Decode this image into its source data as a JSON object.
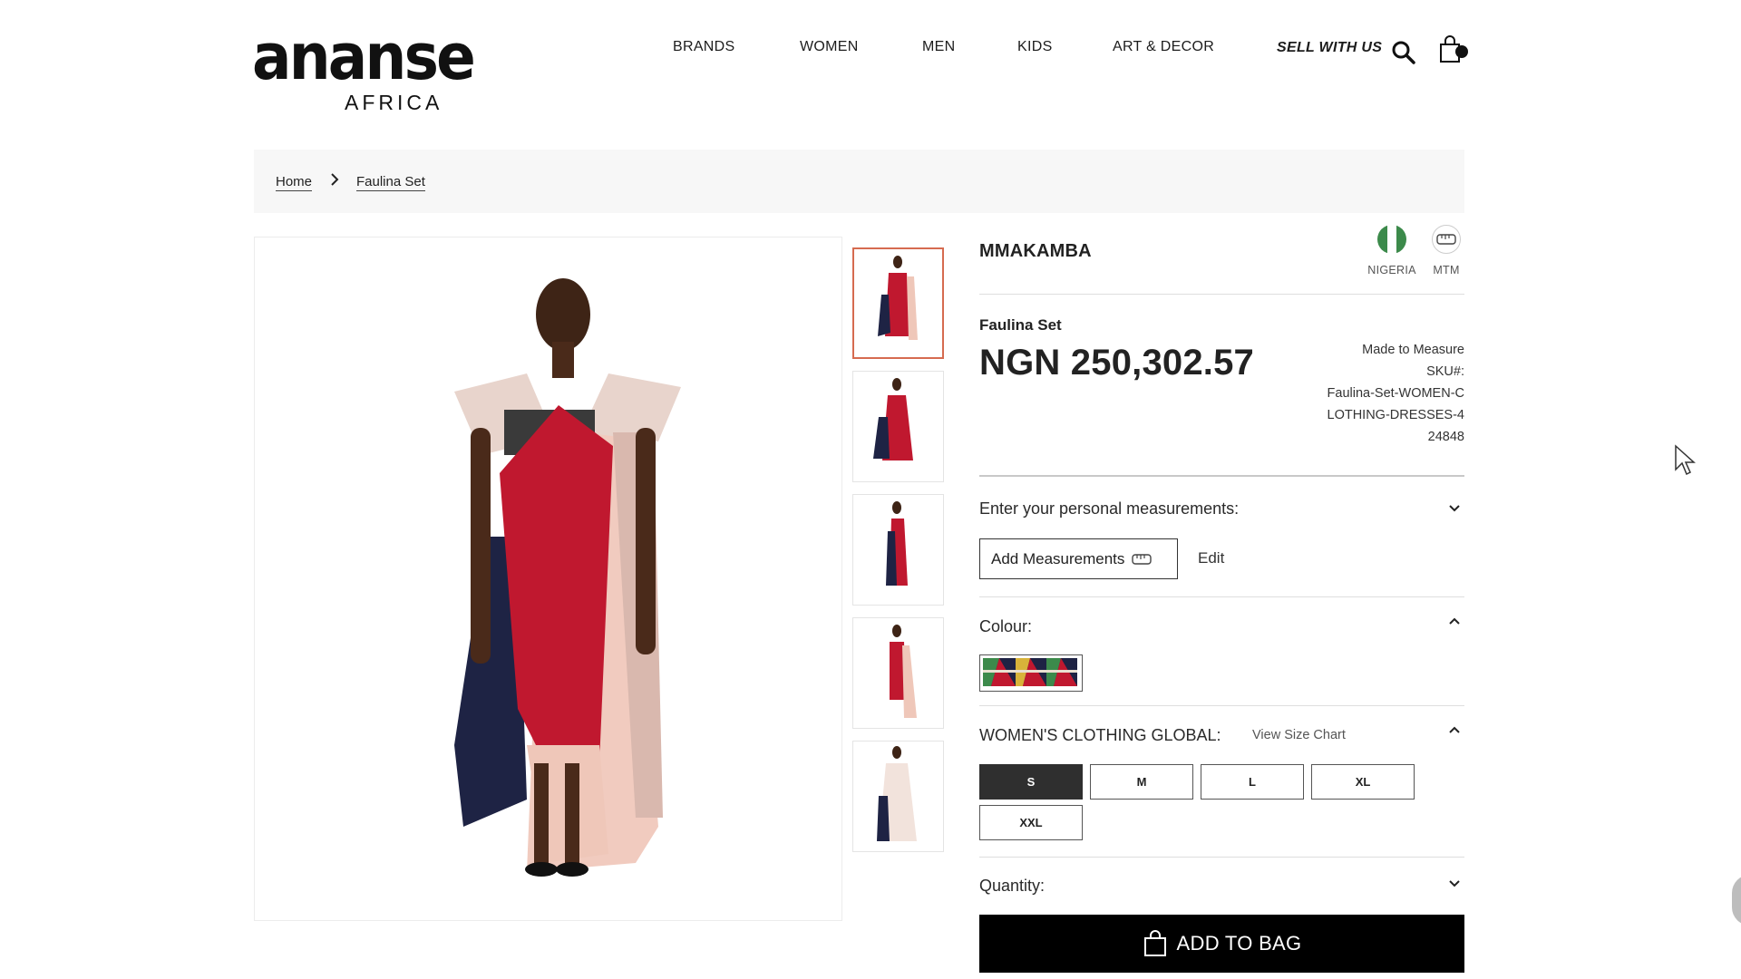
{
  "header": {
    "logo_main": "ananse",
    "logo_sub": "AFRICA",
    "nav": [
      "BRANDS",
      "WOMEN",
      "MEN",
      "KIDS",
      "ART & DECOR"
    ],
    "sell_label": "SELL WITH US",
    "search_icon": "search-icon",
    "bag_icon": "shopping-bag-icon"
  },
  "breadcrumb": {
    "home": "Home",
    "current": "Faulina Set"
  },
  "gallery": {
    "thumbnail_count": 5,
    "active_index": 0
  },
  "product": {
    "brand": "MMAKAMBA",
    "origin_label": "NIGERIA",
    "mtm_label": "MTM",
    "name": "Faulina Set",
    "price": "NGN 250,302.57",
    "made_to": "Made to Measure",
    "sku_label": "SKU#:",
    "sku_line1": "Faulina-Set-WOMEN-C",
    "sku_line2": "LOTHING-DRESSES-4",
    "sku_line3": "24848"
  },
  "measurements": {
    "label": "Enter your personal measurements:",
    "add_button": "Add Measurements",
    "edit_link": "Edit"
  },
  "colour": {
    "label": "Colour:"
  },
  "sizes": {
    "label": "WOMEN'S CLOTHING GLOBAL:",
    "size_chart_link": "View Size Chart",
    "options": [
      "S",
      "M",
      "L",
      "XL",
      "XXL"
    ],
    "selected": "S"
  },
  "quantity": {
    "label": "Quantity:"
  },
  "cta": {
    "add_to_bag": "ADD TO BAG"
  },
  "colors": {
    "flag_green": "#3c8a4b",
    "dress_red": "#c0182f",
    "navy": "#1e2344",
    "cta_bg": "#000000",
    "active_thumb_border": "#d66b50"
  }
}
